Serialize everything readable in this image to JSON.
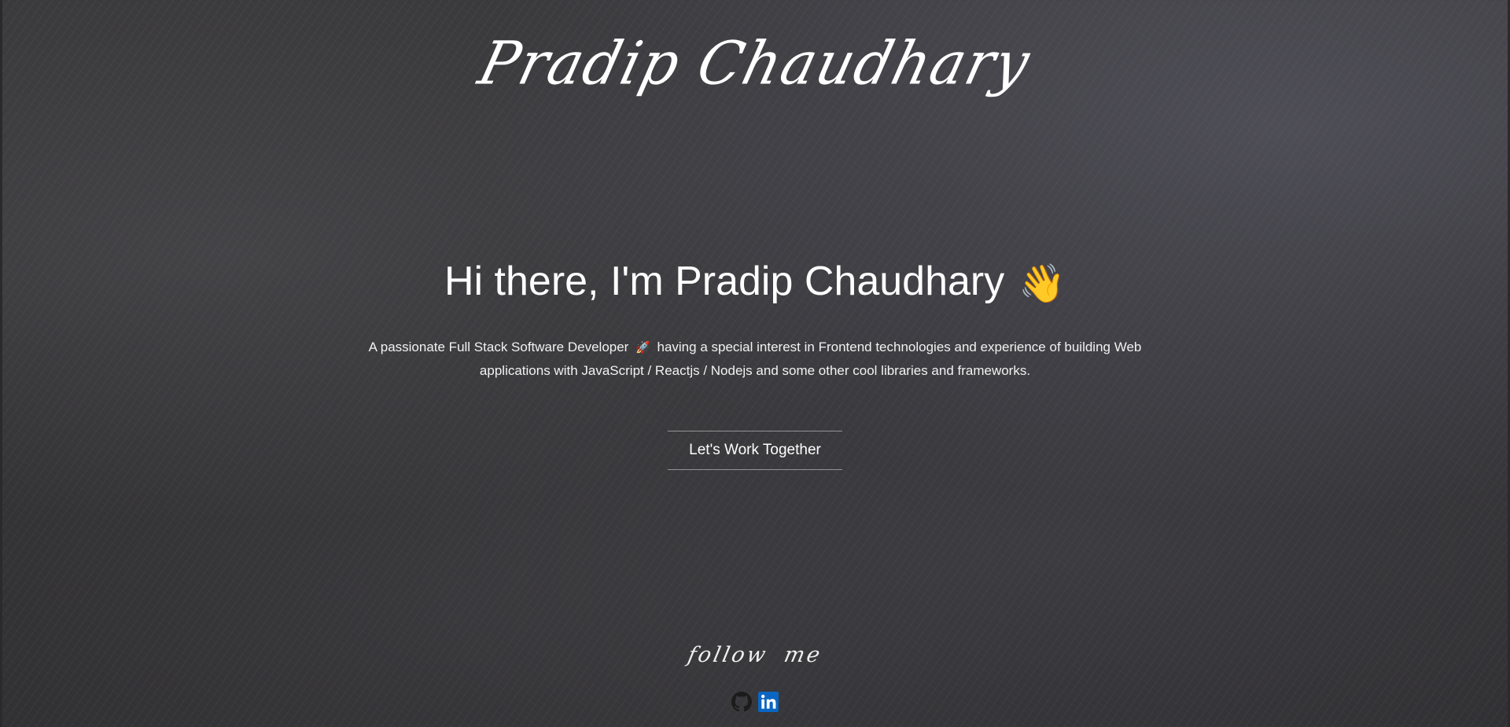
{
  "site": {
    "logo": "Pradip Chaudhary"
  },
  "hero": {
    "headline": "Hi there, I'm Pradip Chaudhary",
    "wave_emoji": "👋",
    "intro_before_icon": "A passionate Full Stack Software Developer",
    "rocket_emoji": "🚀",
    "intro_after_icon": "having a special interest in Frontend technologies and experience of building Web applications with JavaScript / Reactjs / Nodejs and some other cool libraries and frameworks."
  },
  "cta": {
    "label": "Let's Work Together"
  },
  "follow": {
    "label": "follow me",
    "links": [
      {
        "icon": "github-icon",
        "color": "#1b1b1b"
      },
      {
        "icon": "linkedin-icon",
        "color": "#0a66c2"
      }
    ]
  },
  "colors": {
    "background": "#353437",
    "text": "#ffffff"
  }
}
